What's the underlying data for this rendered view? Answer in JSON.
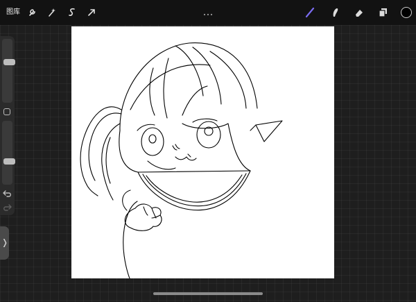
{
  "toolbar": {
    "gallery_label": "图库",
    "left_tools": [
      "wrench-icon",
      "magic-wand-icon",
      "selection-icon",
      "transform-arrow-icon"
    ],
    "right_tools": [
      "brush-icon",
      "smudge-icon",
      "eraser-icon",
      "layers-icon"
    ],
    "brush_color": "#7b6cf0",
    "current_color": "#000000"
  },
  "sidebar": {
    "brush_size_level": 0.35,
    "opacity_level": 0.65
  },
  "canvas": {
    "background": "#ffffff",
    "line_color": "#000000"
  }
}
